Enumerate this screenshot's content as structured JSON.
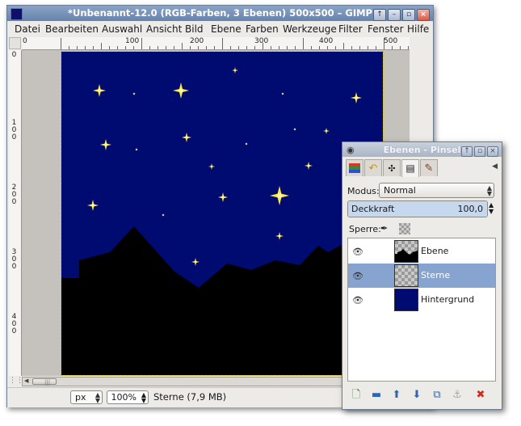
{
  "main_window": {
    "title": "*Unbenannt-12.0 (RGB-Farben, 3 Ebenen) 500x500 – GIMP",
    "window_buttons": [
      "↑",
      "–",
      "▫",
      "×"
    ],
    "menu": [
      "Datei",
      "Bearbeiten",
      "Auswahl",
      "Ansicht",
      "Bild",
      "Ebene",
      "Farben",
      "Werkzeuge",
      "Filter",
      "Fenster",
      "Hilfe"
    ],
    "ruler_top": [
      "0",
      "100",
      "200",
      "300",
      "400",
      "500"
    ],
    "ruler_left": [
      "0",
      "100",
      "200",
      "300",
      "400"
    ],
    "statusbar": {
      "unit": "px",
      "zoom": "100%",
      "status": "Sterne (7,9 MB)"
    }
  },
  "layers_dialog": {
    "title": "Ebenen - Pinsel",
    "mode_label": "Modus:",
    "mode_value": "Normal",
    "opacity_label": "Deckkraft",
    "opacity_value": "100,0",
    "opacity_fraction": 1.0,
    "lock_label": "Sperre:",
    "tab_icons": [
      "layers-tab-icon",
      "undo-history-tab-icon",
      "paths-tab-icon",
      "channels-tab-icon",
      "brush-tab-icon"
    ],
    "layers": [
      {
        "name": "Ebene",
        "visible": true,
        "thumbnail": "checker-with-black-silhouette",
        "selected": false
      },
      {
        "name": "Sterne",
        "visible": true,
        "thumbnail": "checker",
        "selected": true
      },
      {
        "name": "Hintergrund",
        "visible": true,
        "thumbnail": "solid-navy",
        "selected": false
      }
    ],
    "bottom_buttons": [
      "new-layer",
      "layer-group",
      "raise-layer",
      "lower-layer",
      "duplicate-layer",
      "anchor-layer",
      "delete-layer"
    ]
  },
  "colors": {
    "sky": "#000b72",
    "star": "#ffe83a",
    "selection": "#86a4cf",
    "titlebar": "#6683ad"
  }
}
